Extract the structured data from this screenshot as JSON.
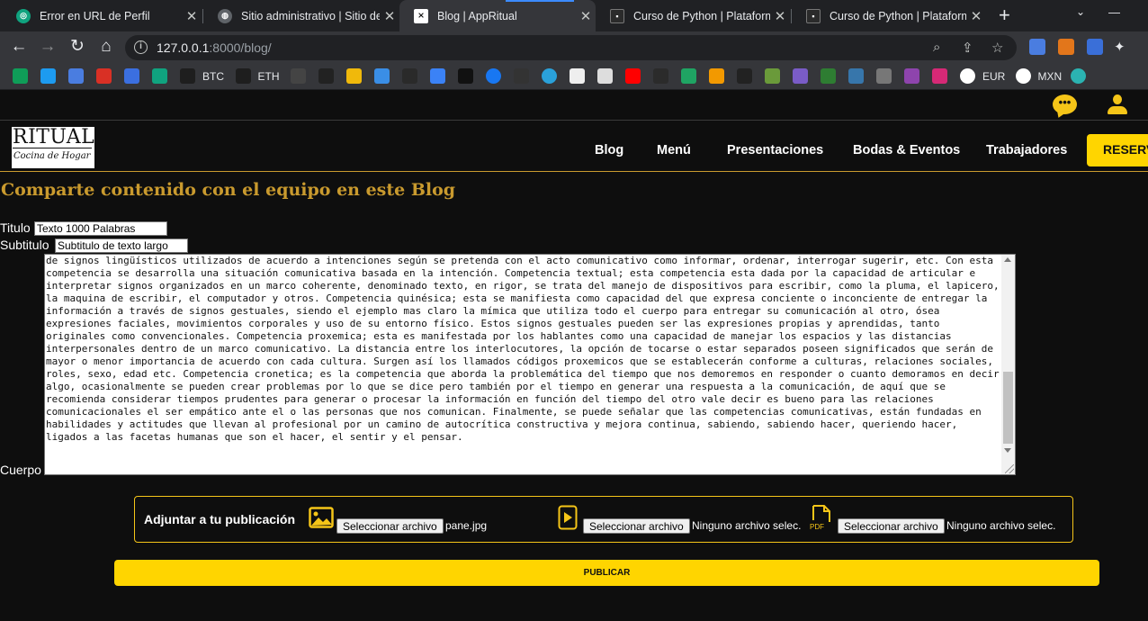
{
  "browser": {
    "tabs": [
      {
        "title": "Error en URL de Perfil",
        "icon": "chatgpt-icon"
      },
      {
        "title": "Sitio administrativo | Sitio de",
        "icon": "globe-icon"
      },
      {
        "title": "Blog | AppRitual",
        "icon": "appritual-icon"
      },
      {
        "title": "Curso de Python | Plataforma",
        "icon": "coder-icon"
      },
      {
        "title": "Curso de Python | Plataforma",
        "icon": "coder-icon"
      }
    ],
    "url_host": "127.0.0.1",
    "url_path": ":8000/blog/",
    "bookmarks": [
      {
        "label": "",
        "icon": "sheets-icon"
      },
      {
        "label": "",
        "icon": "twitter-icon"
      },
      {
        "label": "",
        "icon": "translate-icon"
      },
      {
        "label": "",
        "icon": "gmail-icon"
      },
      {
        "label": "",
        "icon": "at-icon"
      },
      {
        "label": "",
        "icon": "chatgpt-icon"
      },
      {
        "label": "BTC",
        "icon": "tradingview-icon"
      },
      {
        "label": "ETH",
        "icon": "tradingview-icon"
      },
      {
        "label": "",
        "icon": "unicorn-icon"
      },
      {
        "label": "",
        "icon": "exchange-icon"
      },
      {
        "label": "",
        "icon": "binance-icon"
      },
      {
        "label": "",
        "icon": "q-icon"
      },
      {
        "label": "",
        "icon": "chainlink-icon"
      },
      {
        "label": "",
        "icon": "compass-icon"
      },
      {
        "label": "",
        "icon": "lines-icon"
      },
      {
        "label": "",
        "icon": "fb-icon"
      },
      {
        "label": "",
        "icon": "investing-icon"
      },
      {
        "label": "",
        "icon": "telegram-icon"
      },
      {
        "label": "",
        "icon": "wallet-icon"
      },
      {
        "label": "",
        "icon": "camera-icon"
      },
      {
        "label": "",
        "icon": "youtube-icon"
      },
      {
        "label": "",
        "icon": "coder-icon"
      },
      {
        "label": "",
        "icon": "drive-icon"
      },
      {
        "label": "",
        "icon": "infinity-icon"
      },
      {
        "label": "",
        "icon": "github-icon"
      },
      {
        "label": "",
        "icon": "frog-icon"
      },
      {
        "label": "",
        "icon": "x-icon"
      },
      {
        "label": "",
        "icon": "w-icon"
      },
      {
        "label": "",
        "icon": "python-icon"
      },
      {
        "label": "",
        "icon": "globe-icon"
      },
      {
        "label": "",
        "icon": "shield-icon"
      },
      {
        "label": "",
        "icon": "instagram-icon"
      },
      {
        "label": "EUR",
        "icon": "google-icon"
      },
      {
        "label": "MXN",
        "icon": "google-icon"
      },
      {
        "label": "",
        "icon": "dot-icon"
      }
    ]
  },
  "site": {
    "logo_line1": "RITUAL",
    "logo_line2": "Cocina de Hogar",
    "nav": [
      "Blog",
      "Menú",
      "Presentaciones",
      "Bodas & Eventos",
      "Trabajadores"
    ],
    "cta": "RESERVA",
    "heading": "Comparte contenido con el equipo en este Blog"
  },
  "form": {
    "titulo_label": "Titulo",
    "titulo_value": "Texto 1000 Palabras",
    "subtitulo_label": "Subtitulo",
    "subtitulo_value": "Subtitulo de texto largo",
    "cuerpo_label": "Cuerpo",
    "cuerpo_value": "competencia pragmática, es la que se utiliza en forma estratégica en un medio social determinado, ésta establece acciones sociales mediante el empleo adecuado\nde signos lingüísticos utilizados de acuerdo a intenciones según se pretenda con el acto comunicativo como informar, ordenar, interrogar sugerir, etc. Con esta\ncompetencia se desarrolla una situación comunicativa basada en la intención. Competencia textual; esta competencia esta dada por la capacidad de articular e\ninterpretar signos organizados en un marco coherente, denominado texto, en rigor, se trata del manejo de dispositivos para escribir, como la pluma, el lapicero,\nla maquina de escribir, el computador y otros. Competencia quinésica; esta se manifiesta como capacidad del que expresa conciente o inconciente de entregar la\ninformación a través de signos gestuales, siendo el ejemplo mas claro la mímica que utiliza todo el cuerpo para entregar su comunicación al otro, ósea\nexpresiones faciales, movimientos corporales y uso de su entorno físico. Estos signos gestuales pueden ser las expresiones propias y aprendidas, tanto\noriginales como convencionales. Competencia proxemica; esta es manifestada por los hablantes como una capacidad de manejar los espacios y las distancias\ninterpersonales dentro de un marco comunicativo. La distancia entre los interlocutores, la opción de tocarse o estar separados poseen significados que serán de\nmayor o menor importancia de acuerdo con cada cultura. Surgen así los llamados códigos proxemicos que se establecerán conforme a culturas, relaciones sociales,\nroles, sexo, edad etc. Competencia cronetica; es la competencia que aborda la problemática del tiempo que nos demoremos en responder o cuanto demoramos en decir\nalgo, ocasionalmente se pueden crear problemas por lo que se dice pero también por el tiempo en generar una respuesta a la comunicación, de aquí que se\nrecomienda considerar tiempos prudentes para generar o procesar la información en función del tiempo del otro vale decir es bueno para las relaciones\ncomunicacionales el ser empático ante el o las personas que nos comunican. Finalmente, se puede señalar que las competencias comunicativas, están fundadas en\nhabilidades y actitudes que llevan al profesional por un camino de autocrítica constructiva y mejora continua, sabiendo, sabiendo hacer, queriendo hacer,\nligados a las facetas humanas que son el hacer, el sentir y el pensar.",
    "attach_title": "Adjuntar a tu publicación",
    "file_button": "Seleccionar archivo",
    "image_file": "pane.jpg",
    "video_file": "Ninguno archivo selec.",
    "pdf_file": "Ninguno archivo selec.",
    "pdf_icon_text": "PDF",
    "submit": "PUBLICAR"
  },
  "colors": {
    "accent": "#ffd500",
    "gold": "#c99a2e",
    "background": "#0e0e0e"
  }
}
